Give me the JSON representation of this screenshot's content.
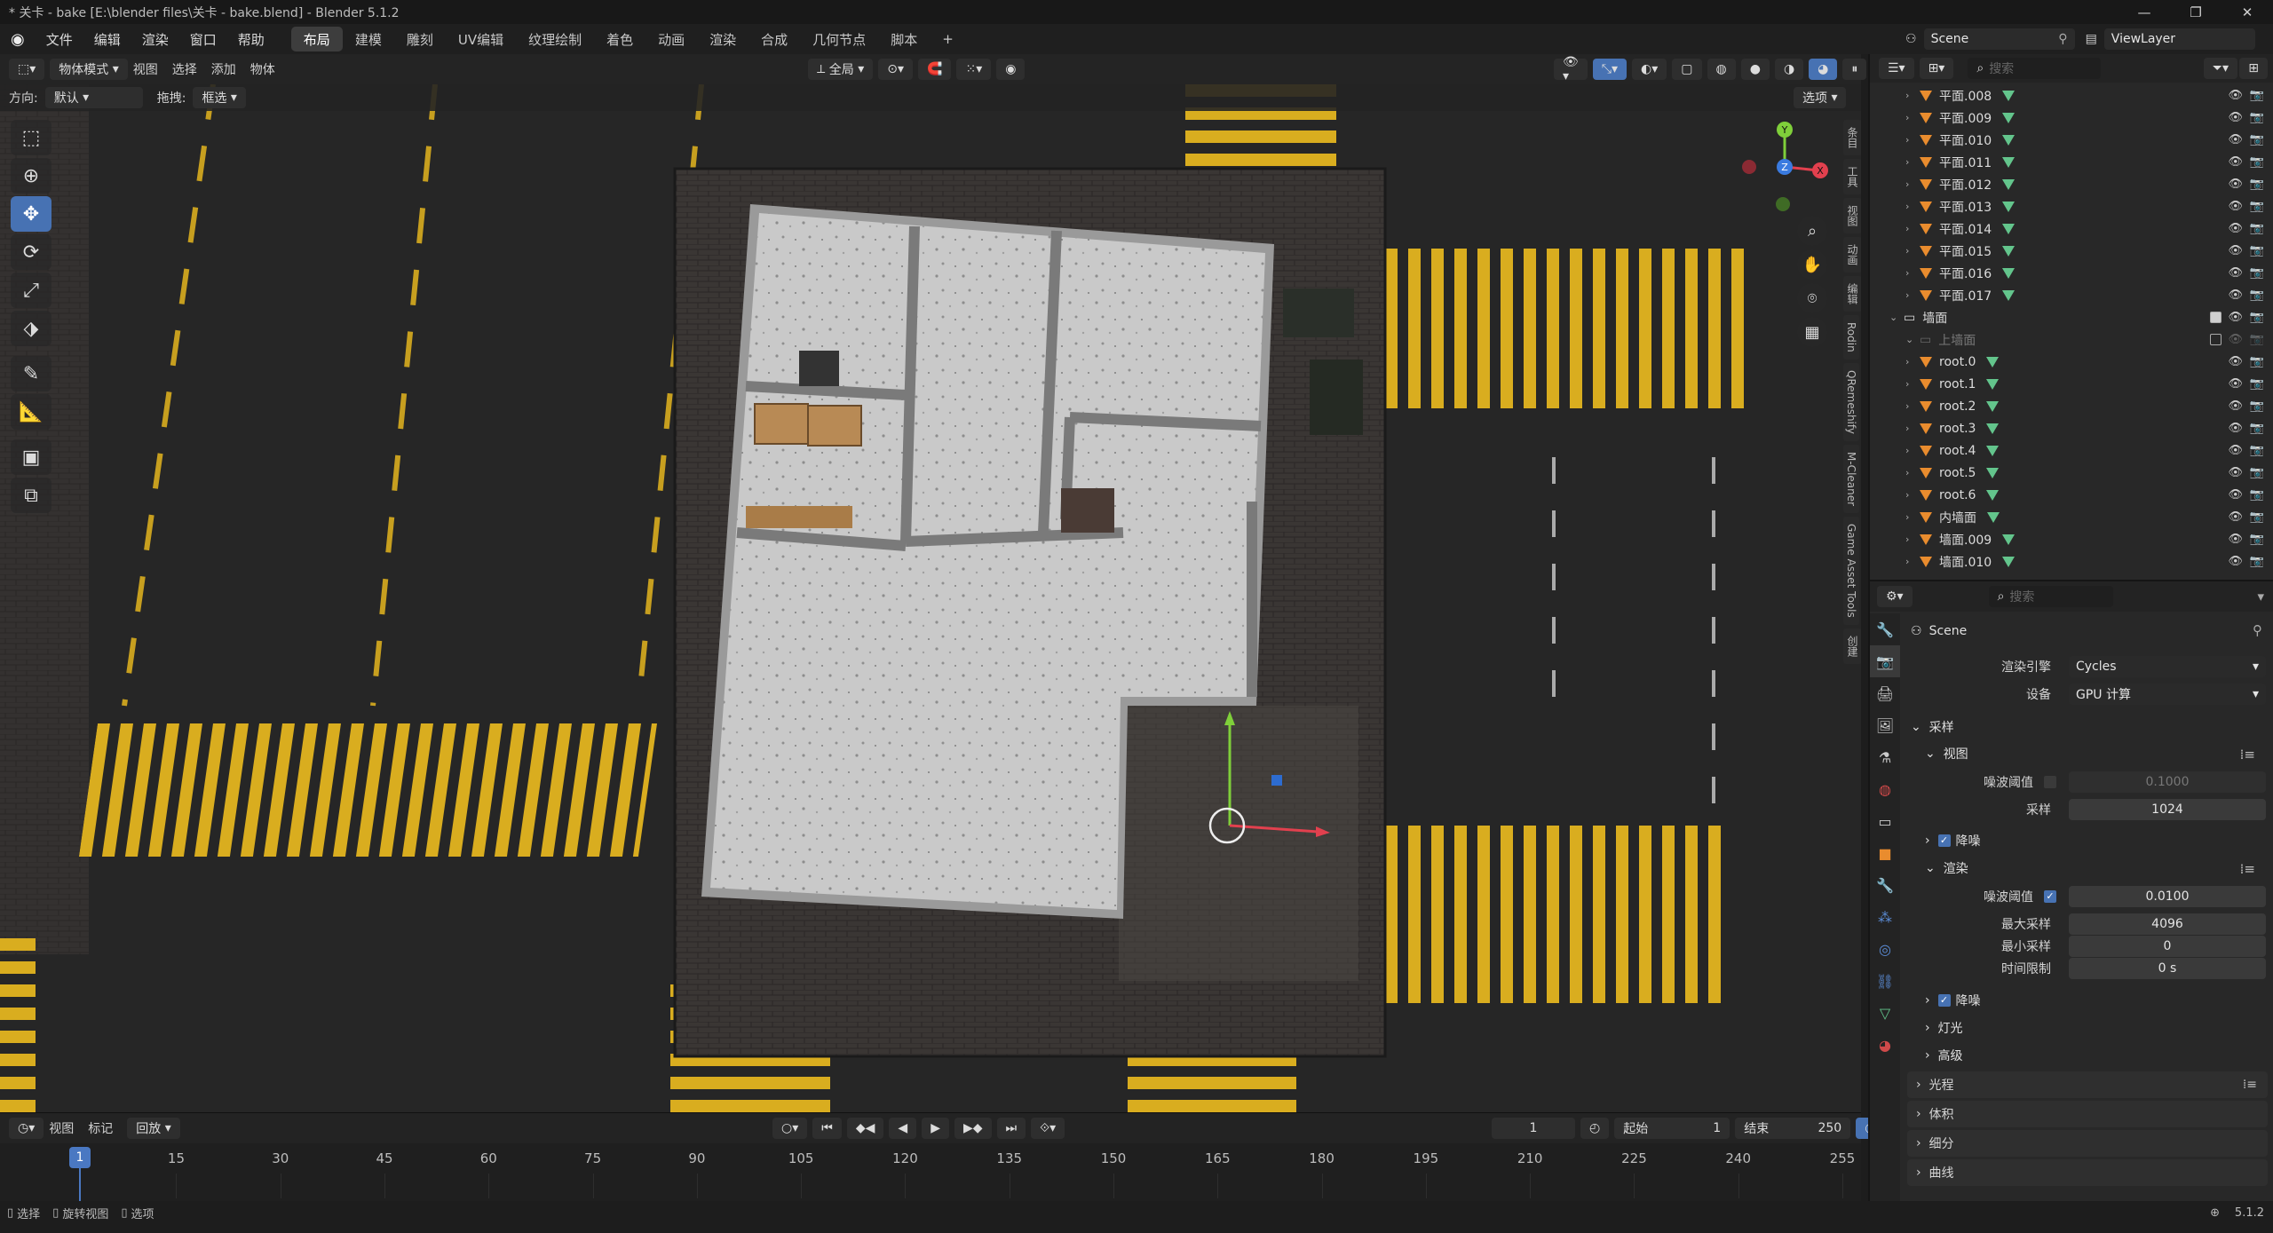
{
  "title_bar": {
    "text": "* 关卡 - bake [E:\\blender files\\关卡 - bake.blend] - Blender 5.1.2",
    "min": "—",
    "max": "❐",
    "close": "✕"
  },
  "menu": {
    "items": [
      "文件",
      "编辑",
      "渲染",
      "窗口",
      "帮助"
    ],
    "workspaces": [
      "布局",
      "建模",
      "雕刻",
      "UV编辑",
      "纹理绘制",
      "着色",
      "动画",
      "渲染",
      "合成",
      "几何节点",
      "脚本"
    ],
    "add_tab": "+",
    "scene": "Scene",
    "view_layer": "ViewLayer"
  },
  "viewport_header": {
    "mode": "物体模式",
    "menus": [
      "视图",
      "选择",
      "添加",
      "物体"
    ],
    "transform_orientation": "全局",
    "orientation_label": "方向:",
    "orientation_value": "默认",
    "drag_label": "拖拽:",
    "drag_value": "框选",
    "options": "选项"
  },
  "side_tabs": [
    "条目",
    "工具",
    "视图",
    "动画",
    "编辑",
    "Rodin",
    "QRemeshify",
    "M-Cleaner",
    "Game Asset Tools",
    "创建"
  ],
  "gizmo": {
    "x": "X",
    "y": "Y",
    "z": "Z"
  },
  "outliner": {
    "search_placeholder": "搜索",
    "rows": [
      {
        "name": "平面.008",
        "indent": 1,
        "type": "mesh"
      },
      {
        "name": "平面.009",
        "indent": 1,
        "type": "mesh"
      },
      {
        "name": "平面.010",
        "indent": 1,
        "type": "mesh"
      },
      {
        "name": "平面.011",
        "indent": 1,
        "type": "mesh"
      },
      {
        "name": "平面.012",
        "indent": 1,
        "type": "mesh"
      },
      {
        "name": "平面.013",
        "indent": 1,
        "type": "mesh"
      },
      {
        "name": "平面.014",
        "indent": 1,
        "type": "mesh"
      },
      {
        "name": "平面.015",
        "indent": 1,
        "type": "mesh"
      },
      {
        "name": "平面.016",
        "indent": 1,
        "type": "mesh"
      },
      {
        "name": "平面.017",
        "indent": 1,
        "type": "mesh"
      },
      {
        "name": "墙面",
        "indent": 0,
        "type": "collection"
      },
      {
        "name": "上墙面",
        "indent": 1,
        "type": "collection-off"
      },
      {
        "name": "root.0",
        "indent": 1,
        "type": "mesh"
      },
      {
        "name": "root.1",
        "indent": 1,
        "type": "mesh"
      },
      {
        "name": "root.2",
        "indent": 1,
        "type": "mesh"
      },
      {
        "name": "root.3",
        "indent": 1,
        "type": "mesh"
      },
      {
        "name": "root.4",
        "indent": 1,
        "type": "mesh"
      },
      {
        "name": "root.5",
        "indent": 1,
        "type": "mesh"
      },
      {
        "name": "root.6",
        "indent": 1,
        "type": "mesh"
      },
      {
        "name": "内墙面",
        "indent": 1,
        "type": "mesh"
      },
      {
        "name": "墙面.009",
        "indent": 1,
        "type": "mesh"
      },
      {
        "name": "墙面.010",
        "indent": 1,
        "type": "mesh"
      }
    ]
  },
  "properties": {
    "search_placeholder": "搜索",
    "scene": "Scene",
    "render_engine_label": "渲染引擎",
    "render_engine": "Cycles",
    "device_label": "设备",
    "device": "GPU 计算",
    "sampling": "采样",
    "viewport": "视图",
    "noise_threshold_label": "噪波阈值",
    "viewport_noise_threshold": "0.1000",
    "samples_label": "采样",
    "viewport_samples": "1024",
    "denoise": "降噪",
    "render": "渲染",
    "render_noise_threshold": "0.0100",
    "max_samples_label": "最大采样",
    "max_samples": "4096",
    "min_samples_label": "最小采样",
    "min_samples": "0",
    "time_limit_label": "时间限制",
    "time_limit": "0 s",
    "lights": "灯光",
    "advanced": "高级",
    "light_paths": "光程",
    "volumes": "体积",
    "subdivision": "细分",
    "curves": "曲线"
  },
  "timeline": {
    "menus": [
      "视图",
      "标记",
      "回放"
    ],
    "current_frame": "1",
    "start_label": "起始",
    "start": "1",
    "end_label": "结束",
    "end": "250",
    "ticks": [
      "15",
      "30",
      "45",
      "60",
      "75",
      "90",
      "105",
      "120",
      "135",
      "150",
      "165",
      "180",
      "195",
      "210",
      "225",
      "240",
      "255"
    ],
    "playhead": "1"
  },
  "status_bar": {
    "select": "选择",
    "rotate_view": "旋转视图",
    "options": "选项",
    "version": "5.1.2"
  },
  "colors": {
    "accent": "#4772b3",
    "mesh_icon": "#e98c2e",
    "data_icon": "#63c58c",
    "road_marking": "#d9ad1f"
  }
}
